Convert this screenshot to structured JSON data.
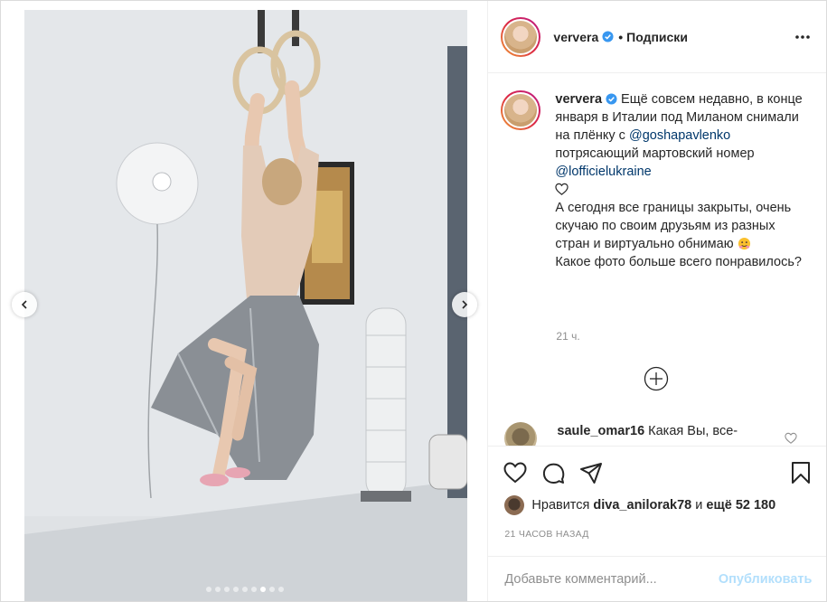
{
  "header": {
    "username": "ververa",
    "separator": "•",
    "follow_label": "Подписки"
  },
  "caption": {
    "username": "ververa",
    "line1": " Ещё совсем недавно, в конце января в Италии под Миланом снимали на плёнку с ",
    "mention1": "@goshapavlenko",
    "line2": " потрясающий мартовский номер ",
    "mention2": "@lofficielukraine",
    "line3": "А сегодня все границы закрыты, очень скучаю по своим друзьям из разных стран и виртуально обнимаю ",
    "line4": "Какое фото больше всего понравилось?",
    "time": "21 ч."
  },
  "comment": {
    "username": "saule_omar16",
    "text": " Какая Вы, все-"
  },
  "likes": {
    "prefix": "Нравится ",
    "user": "diva_anilorak78",
    "middle": " и ",
    "count": "ещё 52 180"
  },
  "post_time": "21 ЧАСОВ НАЗАД",
  "add_comment": {
    "placeholder": "Добавьте комментарий...",
    "publish_label": "Опубликовать"
  },
  "carousel": {
    "total": 9,
    "active": 7
  },
  "colors": {
    "verified": "#3897f0",
    "mention": "#00376b",
    "publish_disabled": "#b2dffc",
    "muted": "#8e8e8e"
  }
}
